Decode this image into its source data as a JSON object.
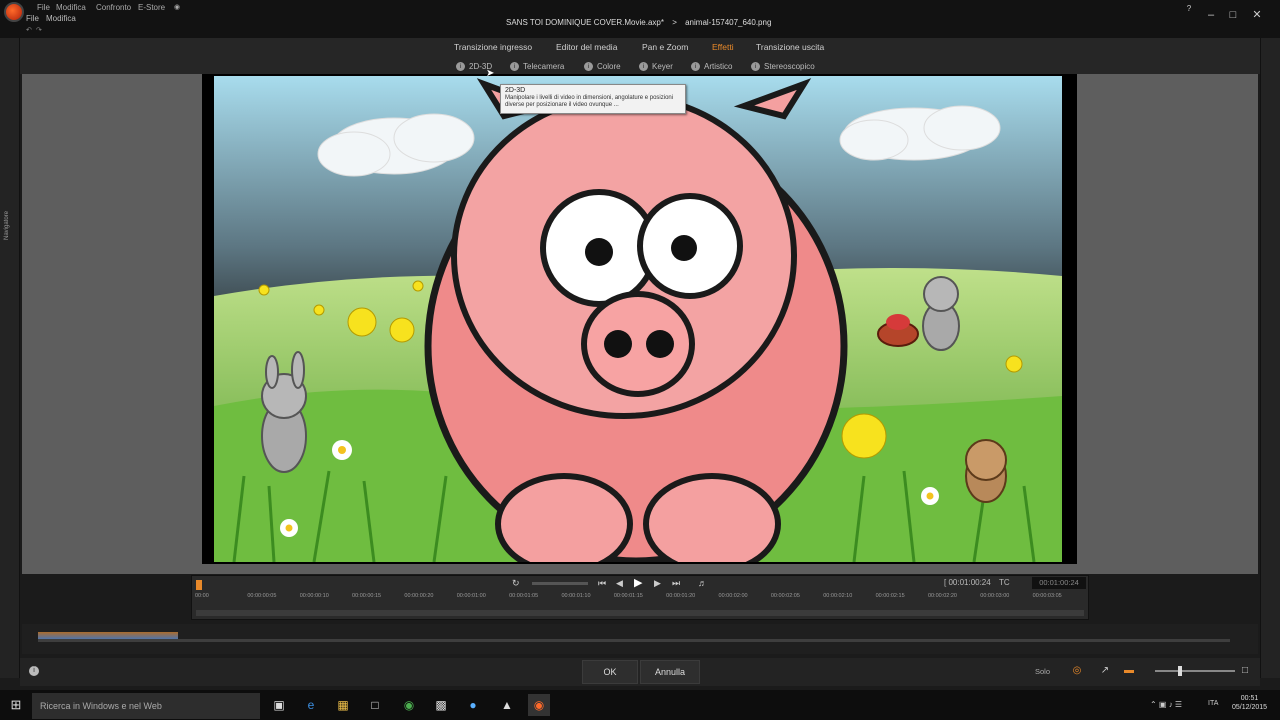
{
  "titlebar": {
    "menu_top": [
      "File",
      "Modifica",
      "Confronto",
      "E-Store"
    ],
    "menu_bottom": [
      "File",
      "Modifica"
    ],
    "document": "SANS TOI DOMINIQUE COVER.Movie.axp*",
    "separator": ">",
    "item": "animal-157407_640.png"
  },
  "tabs": [
    {
      "label": "Transizione ingresso",
      "active": false
    },
    {
      "label": "Editor del media",
      "active": false
    },
    {
      "label": "Pan e Zoom",
      "active": false
    },
    {
      "label": "Effetti",
      "active": true
    },
    {
      "label": "Transizione uscita",
      "active": false
    }
  ],
  "subtabs": [
    "2D-3D",
    "Telecamera",
    "Colore",
    "Keyer",
    "Artistico",
    "Stereoscopico"
  ],
  "left_panel": {
    "label": "Navigatore"
  },
  "tooltip": {
    "title": "2D-3D",
    "body": "Manipolare i livelli di video in dimensioni, angolature e posizioni diverse per posizionare il video ovunque ..."
  },
  "player": {
    "timecode_left": "[ 00:01:00:24",
    "tc_label": "TC",
    "timecode_right": "00:01:00:24",
    "ruler_ticks": [
      "00:00",
      "00:00:00:05",
      "00:00:00:10",
      "00:00:00:15",
      "00:00:00:20",
      "00:00:01:00",
      "00:00:01:05",
      "00:00:01:10",
      "00:00:01:15",
      "00:00:01:20",
      "00:00:02:00",
      "00:00:02:05",
      "00:00:02:10",
      "00:00:02:15",
      "00:00:02:20",
      "00:00:03:00",
      "00:00:03:05"
    ]
  },
  "bottom": {
    "ok": "OK",
    "cancel": "Annulla",
    "solo": "Solo"
  },
  "taskbar": {
    "search_placeholder": "Ricerca in Windows e nel Web",
    "lang": "ITA",
    "time": "00:51",
    "date": "05/12/2015"
  },
  "colors": {
    "accent": "#e8892a",
    "pig": "#f29b9b",
    "sky": "#1a1a1a",
    "grass": "#7cc24a"
  },
  "icons": {
    "start": "windows-logo-icon",
    "play": "play-icon"
  }
}
